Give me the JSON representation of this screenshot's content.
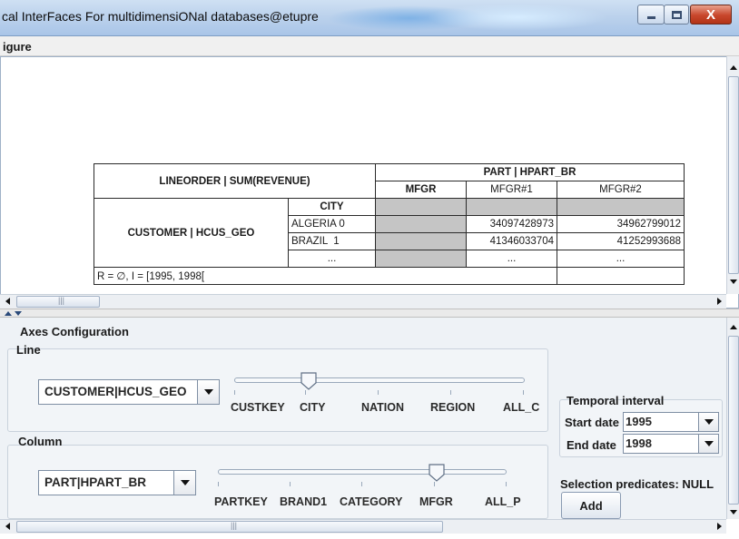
{
  "window": {
    "title": "cal InterFaces For multidimensiONal databases@etupre",
    "controls": {
      "minimize": "",
      "maximize": "",
      "close": "X"
    }
  },
  "menu": {
    "items": [
      "igure"
    ]
  },
  "cube": {
    "measure": "LINEORDER | SUM(REVENUE)",
    "column_dimension": "PART | HPART_BR",
    "column_level": "MFGR",
    "column_members": [
      "MFGR#1",
      "MFGR#2"
    ],
    "row_dimension": "CUSTOMER | HCUS_GEO",
    "row_level": "CITY",
    "rows": [
      {
        "member": "ALGERIA 0",
        "values": [
          "34097428973",
          "34962799012"
        ]
      },
      {
        "member": "BRAZIL  1",
        "values": [
          "41346033704",
          "41252993688"
        ]
      },
      {
        "member": "...",
        "values": [
          "...",
          "..."
        ]
      }
    ],
    "footer": "R = ∅, I = [1995, 1998["
  },
  "axes_config": {
    "title": "Axes Configuration",
    "line": {
      "label": "Line",
      "selected": "CUSTOMER|HCUS_GEO",
      "levels": [
        "CUSTKEY",
        "CITY",
        "NATION",
        "REGION",
        "ALL_C"
      ],
      "slider_index": 1
    },
    "column": {
      "label": "Column",
      "selected": "PART|HPART_BR",
      "levels": [
        "PARTKEY",
        "BRAND1",
        "CATEGORY",
        "MFGR",
        "ALL_P"
      ],
      "slider_index": 3
    }
  },
  "temporal": {
    "title": "Temporal interval",
    "start_label": "Start date",
    "start_value": "1995",
    "end_label": "End date",
    "end_value": "1998"
  },
  "selection": {
    "label": "Selection predicates: NULL",
    "add_button": "Add"
  },
  "scrollbars": {
    "h_thumb_grip": "|||"
  }
}
